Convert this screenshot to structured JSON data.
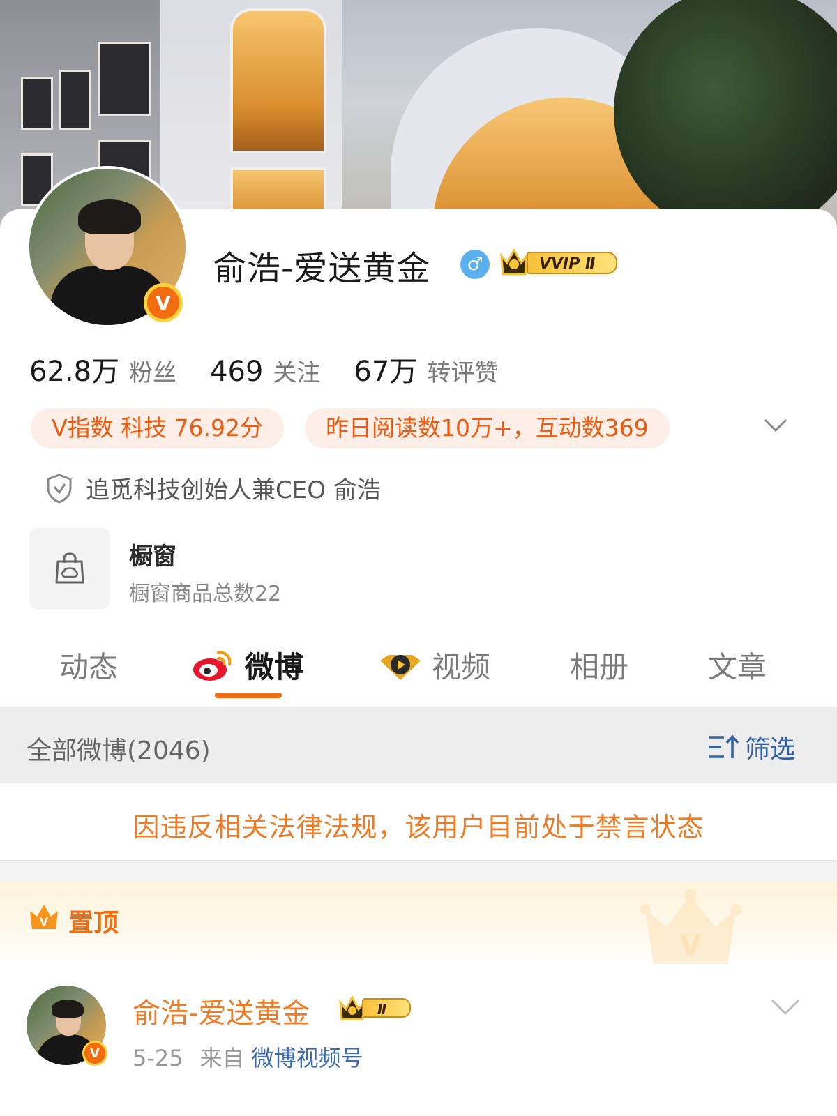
{
  "profile": {
    "name": "俞浩-爱送黄金",
    "gender_symbol": "♂",
    "vip_label": "VVIP Ⅱ",
    "verified_badge": "V"
  },
  "stats": [
    {
      "value": "62.8万",
      "label": "粉丝"
    },
    {
      "value": "469",
      "label": "关注"
    },
    {
      "value": "67万",
      "label": "转评赞"
    }
  ],
  "pills": {
    "v_index": "V指数 科技 76.92分",
    "reads": "昨日阅读数10万+，互动数369"
  },
  "certification": "追觅科技创始人兼CEO 俞浩",
  "shop": {
    "title": "橱窗",
    "subtitle": "橱窗商品总数22"
  },
  "tabs": [
    {
      "label": "动态"
    },
    {
      "label": "微博"
    },
    {
      "label": "视频"
    },
    {
      "label": "相册"
    },
    {
      "label": "文章"
    }
  ],
  "feed": {
    "all_label": "全部微博(2046)",
    "filter_label": "筛选",
    "notice": "因违反相关法律法规，该用户目前处于禁言状态",
    "pinned_label": "置顶"
  },
  "post": {
    "author": "俞浩-爱送黄金",
    "vip_label": "Ⅱ",
    "date": "5-25",
    "from_label": "来自",
    "source": "微博视频号"
  },
  "colors": {
    "accent": "#f26d10",
    "notice": "#f07b24",
    "link": "#3c6ab0"
  }
}
